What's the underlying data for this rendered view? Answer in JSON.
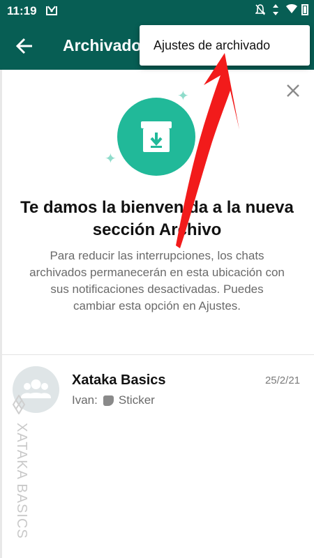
{
  "status_bar": {
    "time": "11:19",
    "icons": [
      "gmail-icon",
      "notifications-off-icon",
      "data-arrows-icon",
      "wifi-icon",
      "battery-icon"
    ]
  },
  "app_bar": {
    "title": "Archivados",
    "background_color": "#075e54"
  },
  "overflow_menu": {
    "items": [
      {
        "label": "Ajustes de archivado"
      }
    ]
  },
  "welcome_card": {
    "title": "Te damos la bienvenida a la nueva sección Archivo",
    "body": "Para reducir las interrupciones, los chats archivados permanecerán en esta ubicación con sus notificaciones desactivadas. Puedes cambiar esta opción en Ajustes.",
    "accent_color": "#21b999"
  },
  "chats": [
    {
      "name": "Xataka Basics",
      "date": "25/2/21",
      "sender": "Ivan:",
      "message": "Sticker",
      "message_icon": "sticker-icon"
    }
  ],
  "watermark": {
    "text": "XATAKA BASICS"
  },
  "annotation": {
    "type": "red-arrow",
    "color": "#f21b1b"
  }
}
